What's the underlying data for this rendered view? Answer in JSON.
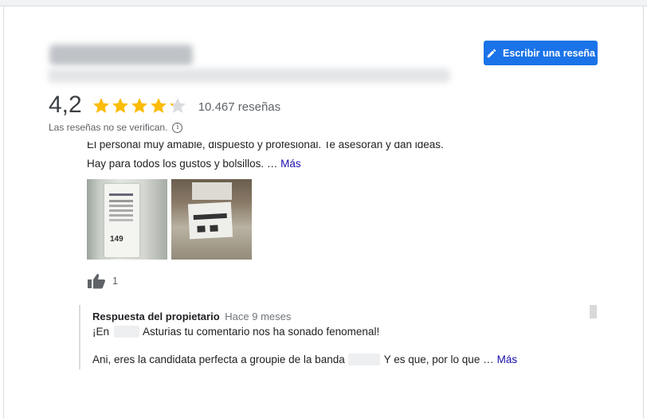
{
  "header": {
    "write_review_label": "Escribir una reseña",
    "colors": {
      "accent": "#1a73e8",
      "star": "#fbbc04",
      "star_empty": "#dadce0",
      "link": "#1a0dab"
    }
  },
  "rating": {
    "value": "4,2",
    "stars": 4.2,
    "stars_max": 5,
    "count_label": "10.467 reseñas",
    "unverified_note": "Las reseñas no se verifican."
  },
  "review": {
    "text_line_1": "El personal muy amable, dispuesto y profesional. Te asesoran y dan ideas.",
    "text_line_2": "Hay para todos los gustos y bolsillos. …",
    "more_label": "Más",
    "photo_1_price": "149",
    "likes": "1"
  },
  "owner_reply": {
    "owner_label": "Respuesta del propietario",
    "time": "Hace 9 meses",
    "line_1_start": "¡En",
    "line_1_end": "Asturias tu comentario nos ha sonado fenomenal!",
    "line_2_start": "Ani, eres la candidata perfecta a groupie de la banda",
    "line_2_end": "Y es que, por lo que …",
    "more_label": "Más"
  },
  "icons": [
    "pencil-icon",
    "star-icon",
    "info-icon",
    "thumbs-up-icon"
  ]
}
